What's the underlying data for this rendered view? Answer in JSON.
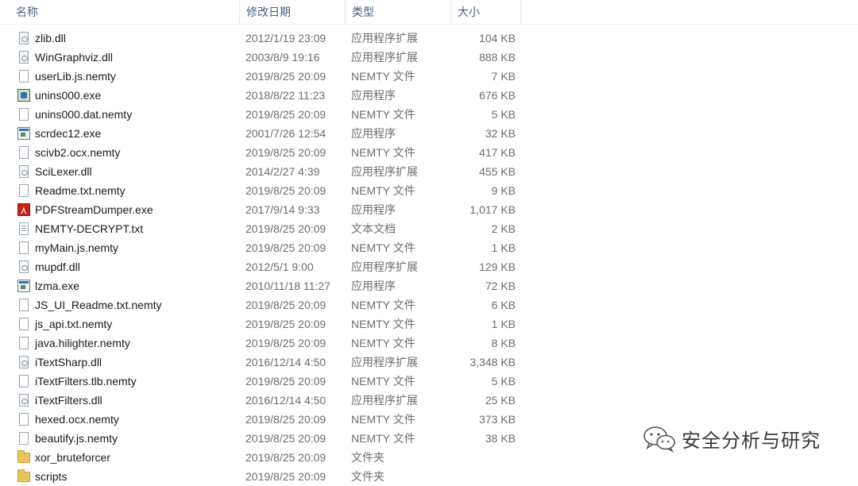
{
  "columns": {
    "name": "名称",
    "date": "修改日期",
    "type": "类型",
    "size": "大小"
  },
  "files": [
    {
      "name": "zlib.dll",
      "date": "2012/1/19 23:09",
      "type": "应用程序扩展",
      "size": "104 KB",
      "icon": "dll-icon"
    },
    {
      "name": "WinGraphviz.dll",
      "date": "2003/8/9 19:16",
      "type": "应用程序扩展",
      "size": "888 KB",
      "icon": "dll-icon"
    },
    {
      "name": "userLib.js.nemty",
      "date": "2019/8/25 20:09",
      "type": "NEMTY 文件",
      "size": "7 KB",
      "icon": "file-icon"
    },
    {
      "name": "unins000.exe",
      "date": "2018/8/22 11:23",
      "type": "应用程序",
      "size": "676 KB",
      "icon": "installer-icon"
    },
    {
      "name": "unins000.dat.nemty",
      "date": "2019/8/25 20:09",
      "type": "NEMTY 文件",
      "size": "5 KB",
      "icon": "file-icon"
    },
    {
      "name": "scrdec12.exe",
      "date": "2001/7/26 12:54",
      "type": "应用程序",
      "size": "32 KB",
      "icon": "exe-icon"
    },
    {
      "name": "scivb2.ocx.nemty",
      "date": "2019/8/25 20:09",
      "type": "NEMTY 文件",
      "size": "417 KB",
      "icon": "file-icon"
    },
    {
      "name": "SciLexer.dll",
      "date": "2014/2/27 4:39",
      "type": "应用程序扩展",
      "size": "455 KB",
      "icon": "dll-icon"
    },
    {
      "name": "Readme.txt.nemty",
      "date": "2019/8/25 20:09",
      "type": "NEMTY 文件",
      "size": "9 KB",
      "icon": "file-icon"
    },
    {
      "name": "PDFStreamDumper.exe",
      "date": "2017/9/14 9:33",
      "type": "应用程序",
      "size": "1,017 KB",
      "icon": "pdf-icon"
    },
    {
      "name": "NEMTY-DECRYPT.txt",
      "date": "2019/8/25 20:09",
      "type": "文本文档",
      "size": "2 KB",
      "icon": "text-file-icon"
    },
    {
      "name": "myMain.js.nemty",
      "date": "2019/8/25 20:09",
      "type": "NEMTY 文件",
      "size": "1 KB",
      "icon": "file-icon"
    },
    {
      "name": "mupdf.dll",
      "date": "2012/5/1 9:00",
      "type": "应用程序扩展",
      "size": "129 KB",
      "icon": "dll-icon"
    },
    {
      "name": "lzma.exe",
      "date": "2010/11/18 11:27",
      "type": "应用程序",
      "size": "72 KB",
      "icon": "exe-icon"
    },
    {
      "name": "JS_UI_Readme.txt.nemty",
      "date": "2019/8/25 20:09",
      "type": "NEMTY 文件",
      "size": "6 KB",
      "icon": "file-icon"
    },
    {
      "name": "js_api.txt.nemty",
      "date": "2019/8/25 20:09",
      "type": "NEMTY 文件",
      "size": "1 KB",
      "icon": "file-icon"
    },
    {
      "name": "java.hilighter.nemty",
      "date": "2019/8/25 20:09",
      "type": "NEMTY 文件",
      "size": "8 KB",
      "icon": "file-icon"
    },
    {
      "name": "iTextSharp.dll",
      "date": "2016/12/14 4:50",
      "type": "应用程序扩展",
      "size": "3,348 KB",
      "icon": "dll-icon"
    },
    {
      "name": "iTextFilters.tlb.nemty",
      "date": "2019/8/25 20:09",
      "type": "NEMTY 文件",
      "size": "5 KB",
      "icon": "file-icon"
    },
    {
      "name": "iTextFilters.dll",
      "date": "2016/12/14 4:50",
      "type": "应用程序扩展",
      "size": "25 KB",
      "icon": "dll-icon"
    },
    {
      "name": "hexed.ocx.nemty",
      "date": "2019/8/25 20:09",
      "type": "NEMTY 文件",
      "size": "373 KB",
      "icon": "file-icon"
    },
    {
      "name": "beautify.js.nemty",
      "date": "2019/8/25 20:09",
      "type": "NEMTY 文件",
      "size": "38 KB",
      "icon": "file-icon"
    },
    {
      "name": "xor_bruteforcer",
      "date": "2019/8/25 20:09",
      "type": "文件夹",
      "size": "",
      "icon": "folder-icon"
    },
    {
      "name": "scripts",
      "date": "2019/8/25 20:09",
      "type": "文件夹",
      "size": "",
      "icon": "folder-icon"
    }
  ],
  "watermark": {
    "text": "安全分析与研究",
    "icon": "wechat-icon"
  }
}
